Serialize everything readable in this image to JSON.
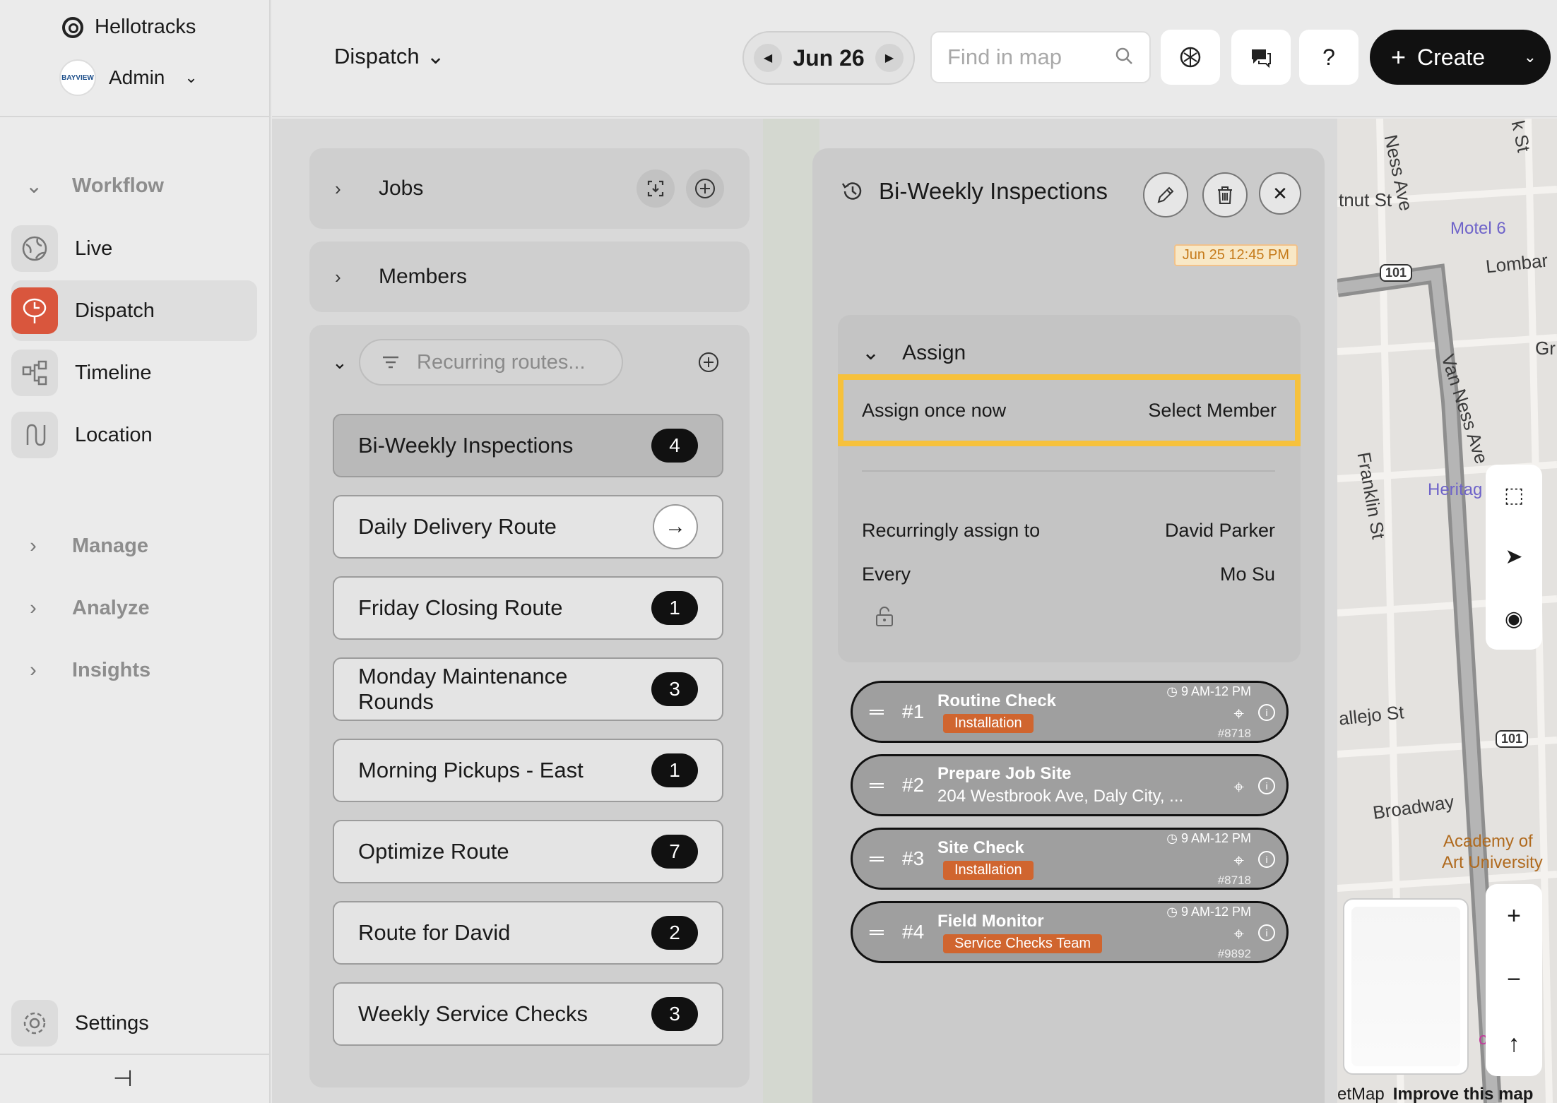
{
  "app": {
    "brand": "Hellotracks",
    "account": "Admin",
    "account_logo_text": "BAYVIEW"
  },
  "sidebar": {
    "workflow_label": "Workflow",
    "items": [
      {
        "label": "Live",
        "icon": "globe-icon"
      },
      {
        "label": "Dispatch",
        "icon": "dispatch-icon"
      },
      {
        "label": "Timeline",
        "icon": "timeline-icon"
      },
      {
        "label": "Location",
        "icon": "location-icon"
      }
    ],
    "groups": [
      "Manage",
      "Analyze",
      "Insights"
    ],
    "settings_label": "Settings"
  },
  "topbar": {
    "view": "Dispatch",
    "date": "Jun 26",
    "search_placeholder": "Find in map",
    "help": "?",
    "create_label": "Create"
  },
  "left_panel": {
    "jobs_label": "Jobs",
    "members_label": "Members",
    "filter_placeholder": "Recurring routes...",
    "routes": [
      {
        "name": "Bi-Weekly Inspections",
        "count": "4",
        "selected": true
      },
      {
        "name": "Daily Delivery Route",
        "count": "",
        "arrow": true
      },
      {
        "name": "Friday Closing Route",
        "count": "1"
      },
      {
        "name": "Monday Maintenance Rounds",
        "count": "3"
      },
      {
        "name": "Morning Pickups - East",
        "count": "1"
      },
      {
        "name": "Optimize Route",
        "count": "7"
      },
      {
        "name": "Route for David",
        "count": "2"
      },
      {
        "name": "Weekly Service Checks",
        "count": "3"
      }
    ]
  },
  "detail": {
    "title": "Bi-Weekly Inspections",
    "timestamp": "Jun 25 12:45 PM",
    "assign_label": "Assign",
    "assign_once_label": "Assign once now",
    "select_member_label": "Select Member",
    "recurring_label": "Recurringly assign to",
    "recurring_value": "David Parker",
    "every_label": "Every",
    "every_value": "Mo Su",
    "jobs": [
      {
        "num": "#1",
        "title": "Routine Check",
        "tag": "Installation",
        "time": "9 AM-12 PM",
        "id": "#8718"
      },
      {
        "num": "#2",
        "title": "Prepare Job Site",
        "subtitle": "204 Westbrook Ave, Daly City, ...",
        "tag": "",
        "time": "",
        "id": ""
      },
      {
        "num": "#3",
        "title": "Site Check",
        "tag": "Installation",
        "time": "9 AM-12 PM",
        "id": "#8718"
      },
      {
        "num": "#4",
        "title": "Field Monitor",
        "tag": "Service Checks Team",
        "time": "9 AM-12 PM",
        "id": "#9892"
      }
    ]
  },
  "map": {
    "labels": {
      "ness_ave": "Ness Ave",
      "chestnut": "tnut St",
      "motel": "Motel 6",
      "lombard": "Lombar",
      "hwy_a": "101",
      "van_ness": "Van Ness Ave",
      "franklin": "Franklin St",
      "heritage": "Heritag",
      "vallejo": "allejo St",
      "broadway": "Broadway",
      "hwy_b": "101",
      "academy_a": "Academy of",
      "academy_b": "Art University",
      "gr": "Gr",
      "st_cut": "k St",
      "ou": "ou"
    },
    "footer_attr": "etMap",
    "footer_link": "Improve this map"
  },
  "colors": {
    "accent_active": "#d9563d",
    "highlight": "#f6c13c",
    "tag": "#d0652f"
  }
}
